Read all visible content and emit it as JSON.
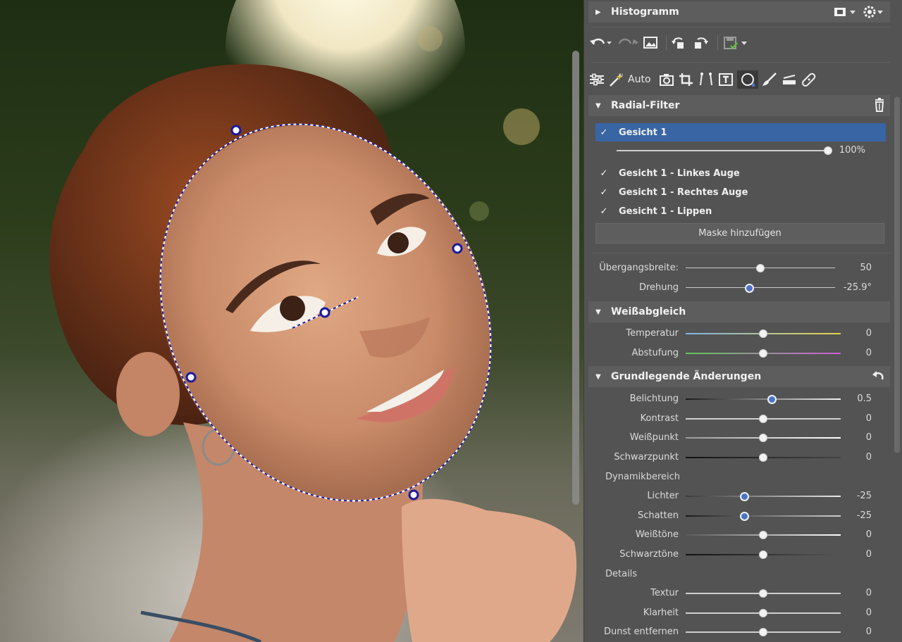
{
  "histogram": {
    "title": "Histogramm"
  },
  "toolbar": {
    "auto_label": "Auto"
  },
  "radial_filter": {
    "title": "Radial-Filter",
    "masks": [
      {
        "label": "Gesicht 1",
        "checked": true,
        "selected": true
      },
      {
        "label": "Gesicht 1 - Linkes Auge",
        "checked": true,
        "selected": false
      },
      {
        "label": "Gesicht 1 - Rechtes Auge",
        "checked": true,
        "selected": false
      },
      {
        "label": "Gesicht 1 - Lippen",
        "checked": true,
        "selected": false
      }
    ],
    "opacity": {
      "value": "100%",
      "fraction": 1.0
    },
    "add_mask_button": "Maske hinzufügen",
    "transition_width": {
      "label": "Übergangsbreite:",
      "value": "50",
      "fraction": 0.5
    },
    "rotation": {
      "label": "Drehung",
      "value": "-25.9°",
      "fraction": 0.43
    }
  },
  "white_balance": {
    "title": "Weißabgleich",
    "temperature": {
      "label": "Temperatur",
      "value": "0",
      "fraction": 0.5
    },
    "tint": {
      "label": "Abstufung",
      "value": "0",
      "fraction": 0.5
    }
  },
  "basic": {
    "title": "Grundlegende Änderungen",
    "exposure": {
      "label": "Belichtung",
      "value": "0.5",
      "fraction": 0.6
    },
    "contrast": {
      "label": "Kontrast",
      "value": "0",
      "fraction": 0.5
    },
    "whitepoint": {
      "label": "Weißpunkt",
      "value": "0",
      "fraction": 0.5
    },
    "blackpoint": {
      "label": "Schwarzpunkt",
      "value": "0",
      "fraction": 0.5
    },
    "dynamic_range_label": "Dynamikbereich",
    "highlights": {
      "label": "Lichter",
      "value": "-25",
      "fraction": 0.375
    },
    "shadows": {
      "label": "Schatten",
      "value": "-25",
      "fraction": 0.375
    },
    "whites": {
      "label": "Weißtöne",
      "value": "0",
      "fraction": 0.5
    },
    "blacks": {
      "label": "Schwarztöne",
      "value": "0",
      "fraction": 0.5
    },
    "details_label": "Details",
    "texture": {
      "label": "Textur",
      "value": "0",
      "fraction": 0.5
    },
    "clarity": {
      "label": "Klarheit",
      "value": "0",
      "fraction": 0.5
    },
    "dehaze": {
      "label": "Dunst entfernen",
      "value": "0",
      "fraction": 0.5
    }
  },
  "colors": {
    "accent": "#3965a4",
    "knob_active": "#4a74c9",
    "mask_outline": "#1a1a9e"
  }
}
